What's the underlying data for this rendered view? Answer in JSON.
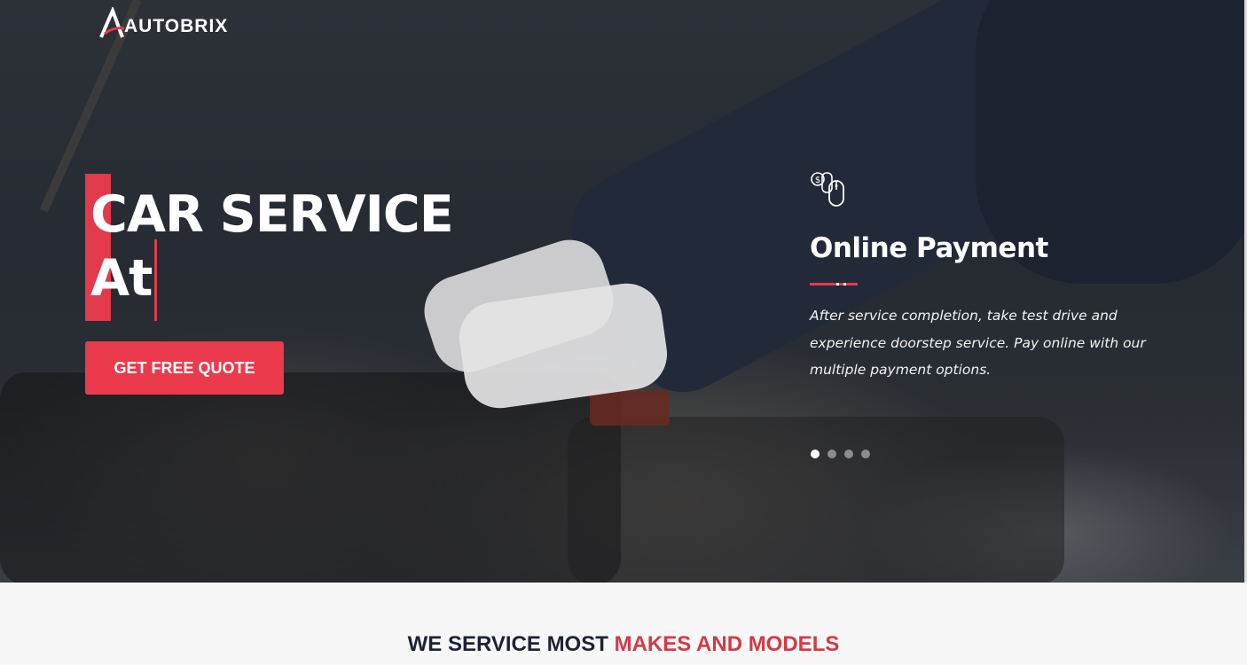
{
  "brand": {
    "name": "AUTOBRIX",
    "accent_color": "#e23a4b"
  },
  "hero": {
    "headline_line1": "CAR SERVICE",
    "headline_line2": "At",
    "cta_label": "GET FREE QUOTE",
    "slide": {
      "icon": "online-payment-icon",
      "title": "Online Payment",
      "body": "After service completion, take test drive and experience doorstep service. Pay online with our multiple payment options."
    },
    "carousel": {
      "total_slides": 4,
      "active_index": 0
    }
  },
  "section": {
    "title_prefix": "WE SERVICE MOST",
    "title_accent": "MAKES AND MODELS"
  }
}
